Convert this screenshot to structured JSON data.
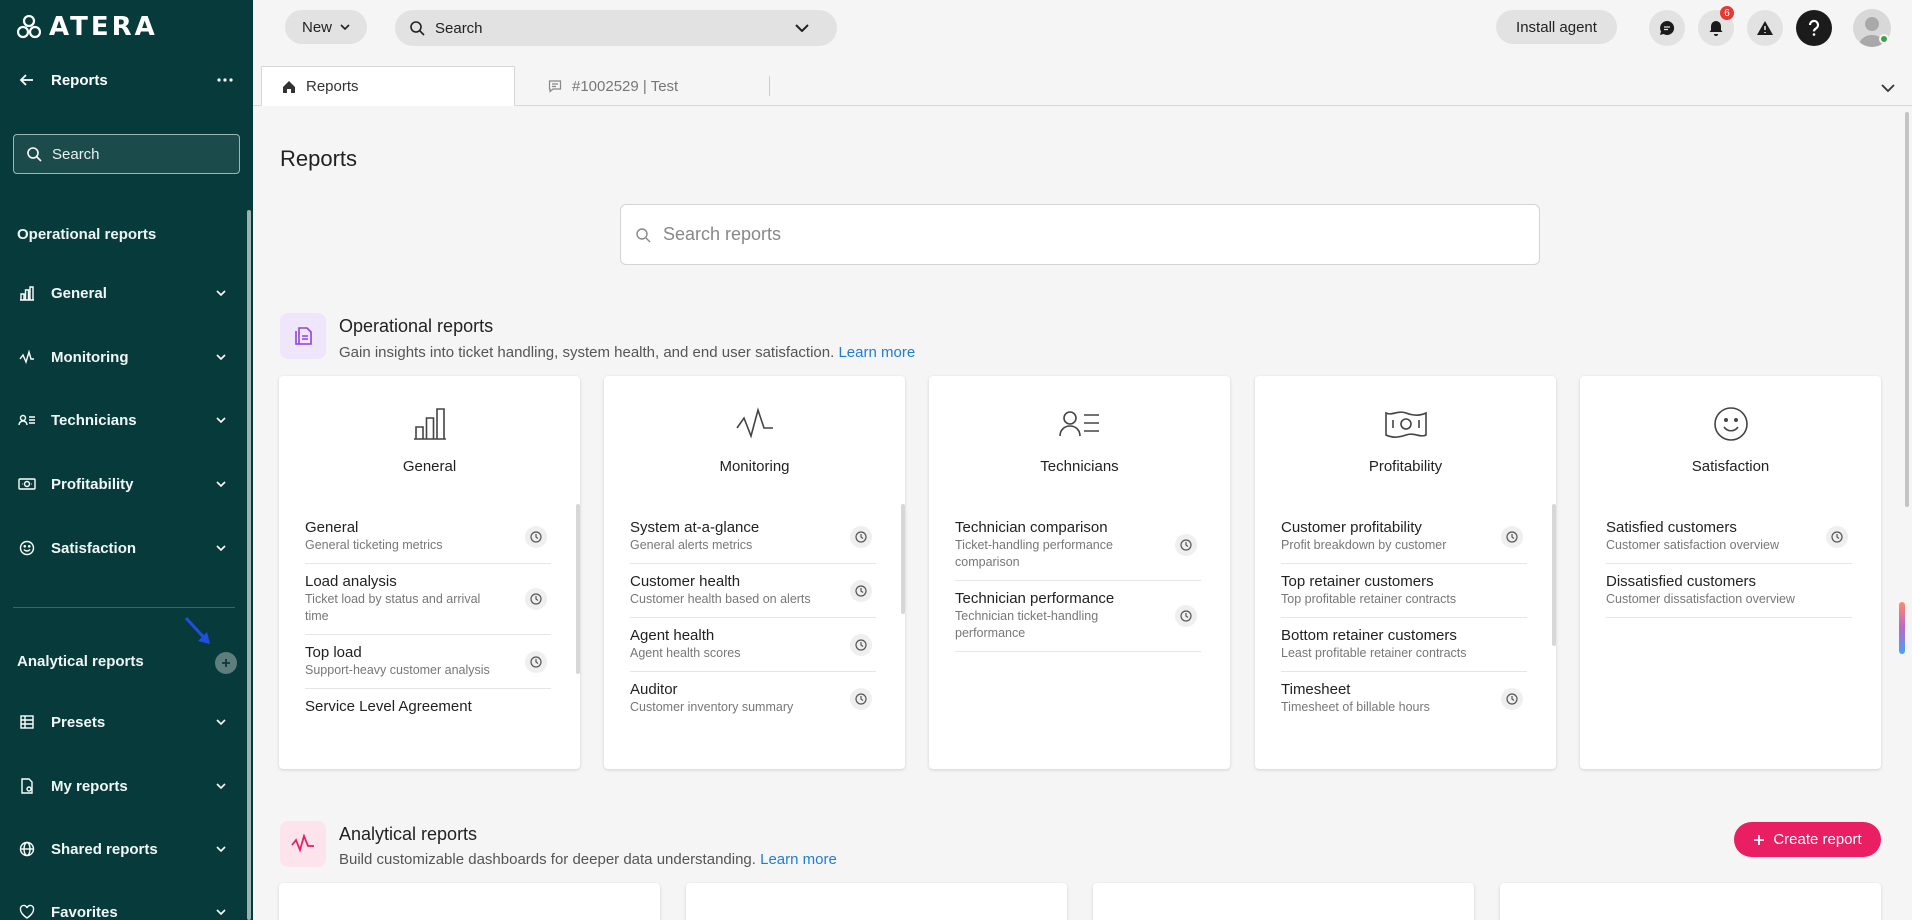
{
  "app": {
    "logo_text": "ATERA"
  },
  "sidebar": {
    "title": "Reports",
    "search_placeholder": "Search",
    "operational_title": "Operational reports",
    "operational_items": [
      {
        "label": "General",
        "icon": "bar-chart-icon"
      },
      {
        "label": "Monitoring",
        "icon": "pulse-icon"
      },
      {
        "label": "Technicians",
        "icon": "technicians-icon"
      },
      {
        "label": "Profitability",
        "icon": "money-icon"
      },
      {
        "label": "Satisfaction",
        "icon": "smiley-icon"
      }
    ],
    "analytical_title": "Analytical reports",
    "analytical_items": [
      {
        "label": "Presets",
        "icon": "grid-icon"
      },
      {
        "label": "My reports",
        "icon": "my-report-icon"
      },
      {
        "label": "Shared reports",
        "icon": "globe-icon"
      },
      {
        "label": "Favorites",
        "icon": "heart-icon"
      }
    ]
  },
  "topbar": {
    "new_label": "New",
    "search_placeholder": "Search",
    "install_label": "Install agent",
    "notification_count": "6"
  },
  "tabs": {
    "reports_label": "Reports",
    "ticket_label": "#1002529 | Test"
  },
  "main": {
    "page_title": "Reports",
    "search_placeholder": "Search reports",
    "operational": {
      "title": "Operational reports",
      "desc": "Gain insights into ticket handling, system health, and end user satisfaction.",
      "link": "Learn more"
    },
    "analytical": {
      "title": "Analytical reports",
      "desc": "Build customizable dashboards for deeper data understanding.",
      "link": "Learn more",
      "create_label": "Create report"
    },
    "cards": [
      {
        "title": "General",
        "icon": "bar-chart-icon",
        "rows": [
          {
            "title": "General",
            "desc": "General ticketing metrics"
          },
          {
            "title": "Load analysis",
            "desc": "Ticket load by status and arrival time"
          },
          {
            "title": "Top load",
            "desc": "Support-heavy customer analysis"
          },
          {
            "title": "Service Level Agreement",
            "desc": ""
          }
        ]
      },
      {
        "title": "Monitoring",
        "icon": "pulse-icon",
        "rows": [
          {
            "title": "System at-a-glance",
            "desc": "General alerts metrics"
          },
          {
            "title": "Customer health",
            "desc": "Customer health based on alerts"
          },
          {
            "title": "Agent health",
            "desc": "Agent health scores"
          },
          {
            "title": "Auditor",
            "desc": "Customer inventory summary"
          }
        ]
      },
      {
        "title": "Technicians",
        "icon": "technicians-icon",
        "rows": [
          {
            "title": "Technician comparison",
            "desc": "Ticket-handling performance comparison"
          },
          {
            "title": "Technician performance",
            "desc": "Technician ticket-handling performance"
          }
        ]
      },
      {
        "title": "Profitability",
        "icon": "money-icon",
        "rows": [
          {
            "title": "Customer profitability",
            "desc": "Profit breakdown by customer"
          },
          {
            "title": "Top retainer customers",
            "desc": "Top profitable retainer contracts"
          },
          {
            "title": "Bottom retainer customers",
            "desc": "Least profitable retainer contracts"
          },
          {
            "title": "Timesheet",
            "desc": "Timesheet of billable hours"
          }
        ]
      },
      {
        "title": "Satisfaction",
        "icon": "smiley-icon",
        "rows": [
          {
            "title": "Satisfied customers",
            "desc": "Customer satisfaction overview"
          },
          {
            "title": "Dissatisfied customers",
            "desc": "Customer dissatisfaction overview"
          }
        ]
      }
    ]
  },
  "colors": {
    "sidebar": "#073b3b",
    "accent_pink": "#e91e63",
    "link": "#1e7ed6",
    "operational_icon_bg": "#efe6fb",
    "analytical_icon_bg": "#fde4ec"
  }
}
